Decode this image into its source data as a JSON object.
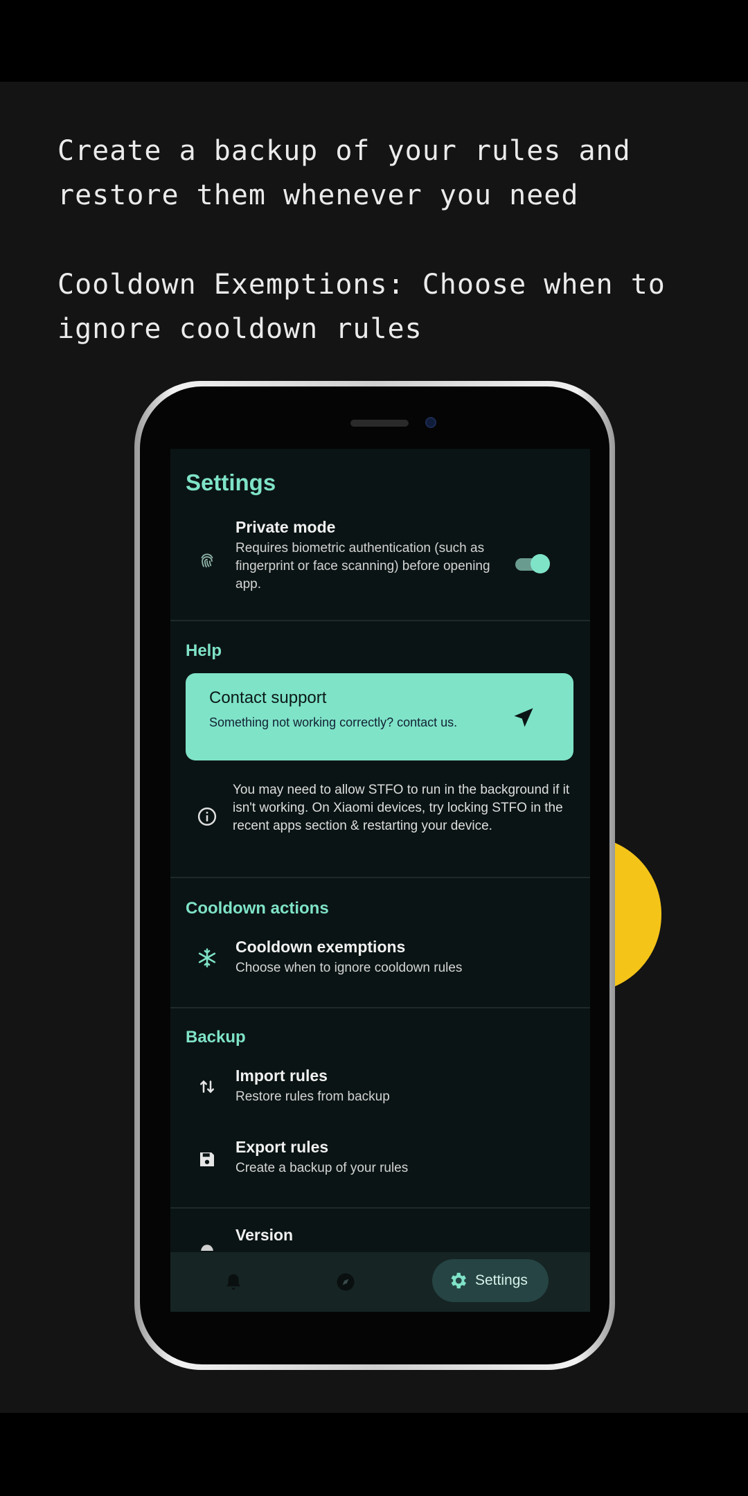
{
  "promo": {
    "line1": "Create a backup of your rules and\nrestore them whenever you need",
    "line2": "Cooldown Exemptions: Choose when to\nignore cooldown rules"
  },
  "app": {
    "title": "Settings",
    "private_mode": {
      "title": "Private mode",
      "subtitle": "Requires biometric authentication (such as fingerprint or face scanning) before opening app.",
      "enabled": true,
      "icon": "fingerprint-icon"
    },
    "help": {
      "label": "Help",
      "contact": {
        "title": "Contact support",
        "subtitle": "Something not working correctly? contact us.",
        "icon": "send-icon"
      },
      "info": "You may need to allow STFO to run in the background if it isn't working. On Xiaomi devices, try locking STFO in the recent apps section & restarting your device."
    },
    "cooldown": {
      "label": "Cooldown actions",
      "exemptions": {
        "title": "Cooldown exemptions",
        "subtitle": "Choose when to ignore cooldown rules",
        "icon": "snowflake-icon"
      }
    },
    "backup": {
      "label": "Backup",
      "import": {
        "title": "Import rules",
        "subtitle": "Restore rules from backup",
        "icon": "swap-vertical-icon"
      },
      "export": {
        "title": "Export rules",
        "subtitle": "Create a backup of your rules",
        "icon": "save-icon"
      }
    },
    "version": {
      "title": "Version"
    },
    "nav": {
      "items": [
        {
          "icon": "bell-icon"
        },
        {
          "icon": "compass-icon"
        },
        {
          "icon": "gear-icon",
          "label": "Settings",
          "active": true
        }
      ]
    }
  },
  "colors": {
    "accent": "#7fe3c8",
    "background": "#141414",
    "screen": "#0b1414",
    "blob": "#f5c419"
  }
}
